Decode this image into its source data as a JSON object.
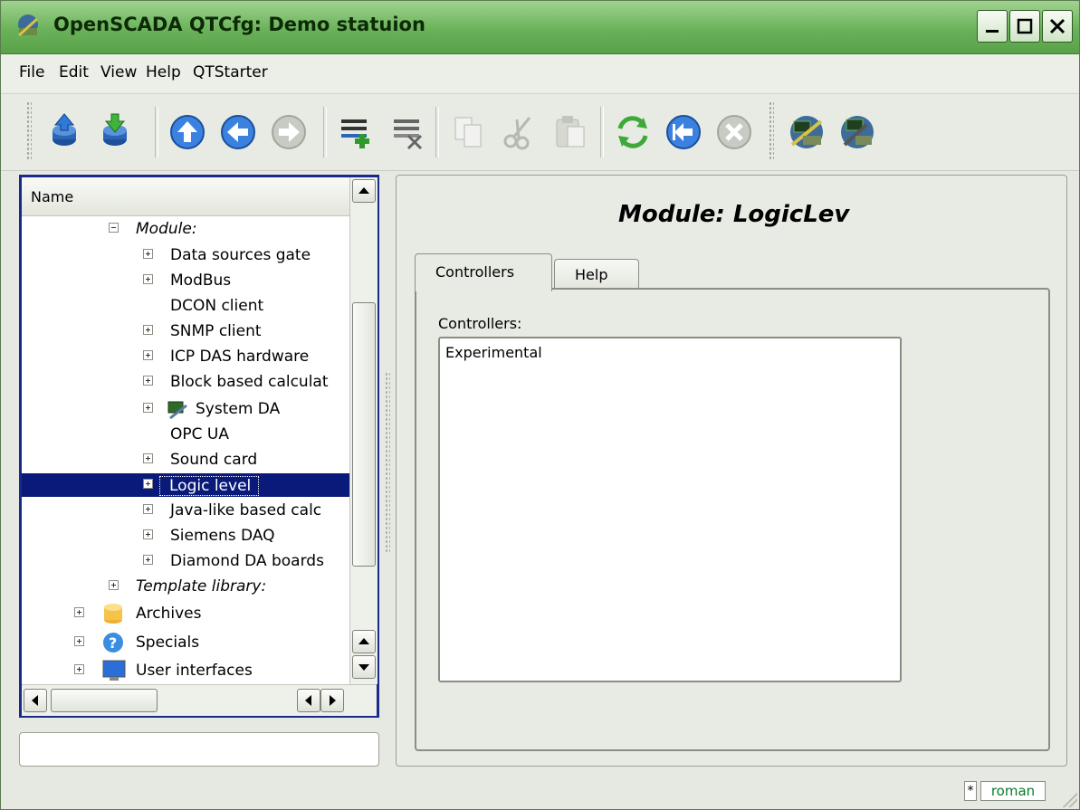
{
  "window": {
    "title": "OpenSCADA QTCfg: Demo statuion",
    "app_icon": "openscada-icon",
    "controls": [
      "minimize-icon",
      "maximize-icon",
      "close-icon"
    ]
  },
  "menubar": {
    "items": [
      "File",
      "Edit",
      "View",
      "Help",
      "QTStarter"
    ]
  },
  "toolbar": {
    "tools": [
      "db-load-icon",
      "db-save-icon",
      "up-icon",
      "back-icon",
      "forward-icon",
      "add-item-icon",
      "delete-item-icon",
      "copy-icon",
      "cut-icon",
      "paste-icon",
      "refresh-icon",
      "start-icon",
      "stop-icon",
      "tool-vision-icon",
      "tool-config-icon"
    ]
  },
  "tree": {
    "header": "Name",
    "rows": [
      {
        "label": "Module:",
        "style": "italic"
      },
      {
        "label": "Data sources gate"
      },
      {
        "label": "ModBus"
      },
      {
        "label": "DCON client"
      },
      {
        "label": "SNMP client"
      },
      {
        "label": "ICP DAS hardware"
      },
      {
        "label": "Block based calculat"
      },
      {
        "label": "System DA"
      },
      {
        "label": "OPC UA"
      },
      {
        "label": "Sound card"
      },
      {
        "label": "Logic level",
        "selected": true
      },
      {
        "label": "Java-like based calc"
      },
      {
        "label": "Siemens DAQ"
      },
      {
        "label": "Diamond DA boards"
      },
      {
        "label": "Template library:",
        "style": "italic"
      },
      {
        "label": "Archives"
      },
      {
        "label": "Specials"
      },
      {
        "label": "User interfaces"
      }
    ]
  },
  "main": {
    "title": "Module: LogicLev",
    "tabs": [
      "Controllers",
      "Help"
    ],
    "active_tab": "Controllers",
    "controllers_label": "Controllers:",
    "controllers_list": [
      "Experimental"
    ]
  },
  "statusbar": {
    "modified_marker": "*",
    "user": "roman"
  },
  "colors": {
    "titlebar": "#6ab259",
    "selection": "#0a1a7a",
    "tree_frame": "#1a2a8a",
    "user_text": "#0a7a2a"
  }
}
